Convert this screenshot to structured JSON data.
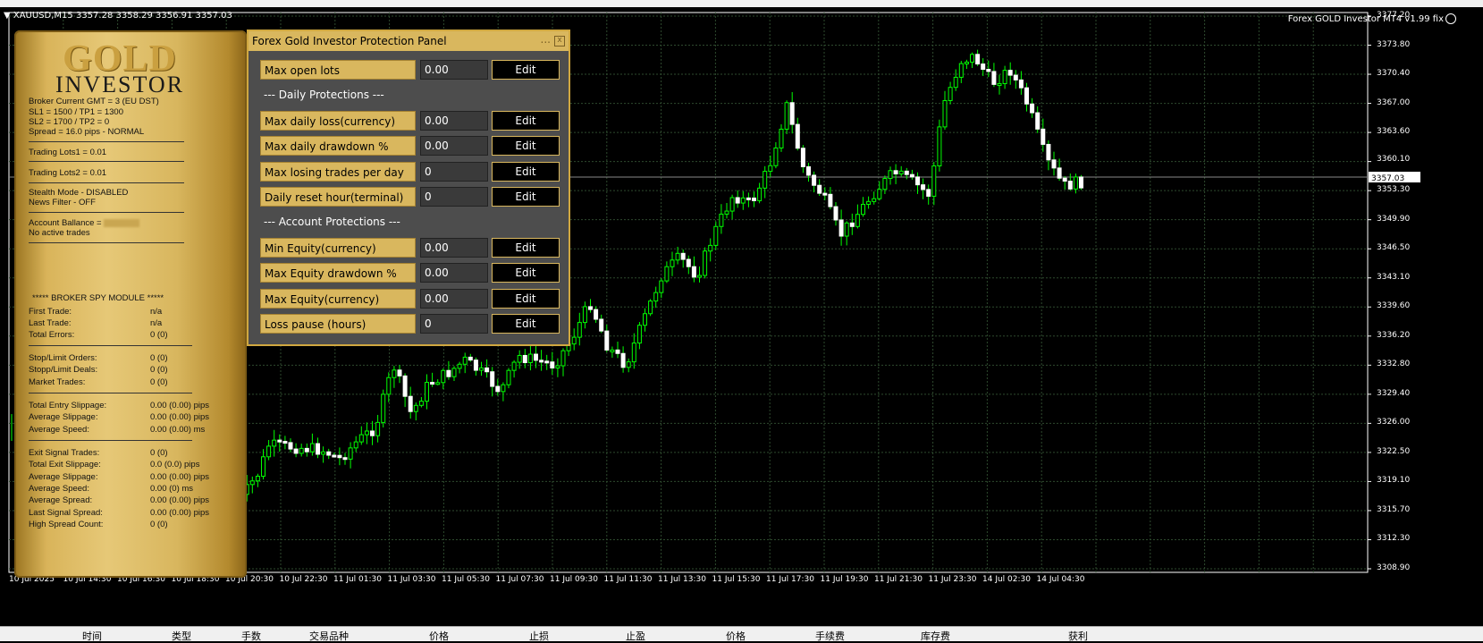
{
  "chart": {
    "title": "▼ XAUUSD,M15  3357.28 3358.29 3356.91 3357.03",
    "ea_title": "Forex GOLD Investor MT4 v1.99 fix",
    "current_price": "3357.03",
    "y_labels": [
      "3377.20",
      "3373.80",
      "3370.40",
      "3367.00",
      "3363.60",
      "3360.10",
      "3353.30",
      "3349.90",
      "3346.50",
      "3343.10",
      "3339.60",
      "3336.20",
      "3332.80",
      "3329.40",
      "3326.00",
      "3322.50",
      "3319.10",
      "3315.70",
      "3312.30",
      "3308.90"
    ],
    "x_labels": [
      "10 Jul 2025",
      "10 Jul 14:30",
      "10 Jul 16:30",
      "10 Jul 18:30",
      "10 Jul 20:30",
      "10 Jul 22:30",
      "11 Jul 01:30",
      "11 Jul 03:30",
      "11 Jul 05:30",
      "11 Jul 07:30",
      "11 Jul 09:30",
      "11 Jul 11:30",
      "11 Jul 13:30",
      "11 Jul 15:30",
      "11 Jul 17:30",
      "11 Jul 19:30",
      "11 Jul 21:30",
      "11 Jul 23:30",
      "14 Jul 02:30",
      "14 Jul 04:30"
    ],
    "colors": {
      "bull": "#00ff00",
      "bear": "#ffffff",
      "grid": "#2e4a2e",
      "background": "#000000"
    }
  },
  "gold_panel": {
    "logo_top": "GOLD",
    "logo_bottom": "INVESTOR",
    "info": [
      "Broker Current GMT = 3  (EU DST)",
      "SL1 = 1500 / TP1 = 1300",
      "SL2 = 1700 / TP2 = 0",
      "Spread = 16.0 pips - NORMAL",
      "Trading Lots1 = 0.01",
      "Trading Lots2 = 0.01",
      "Stealth Mode - DISABLED",
      "News Filter - OFF",
      "Account Ballance =",
      "No active trades"
    ],
    "spy_title": "***** BROKER SPY MODULE *****",
    "stats": [
      {
        "label": "First Trade:",
        "value": "n/a"
      },
      {
        "label": "Last Trade:",
        "value": "n/a"
      },
      {
        "label": "Total Errors:",
        "value": "0 (0)"
      },
      {
        "label": "Stop/Limit Orders:",
        "value": "0 (0)"
      },
      {
        "label": "Stopp/Limit Deals:",
        "value": "0 (0)"
      },
      {
        "label": "Market Trades:",
        "value": "0 (0)"
      },
      {
        "label": "Total Entry Slippage:",
        "value": "0.00 (0.00) pips"
      },
      {
        "label": "Average Slippage:",
        "value": "0.00 (0.00) pips"
      },
      {
        "label": "Average Speed:",
        "value": "0.00 (0.00) ms"
      },
      {
        "label": "Exit Signal Trades:",
        "value": "0 (0)"
      },
      {
        "label": "Total Exit Slippage:",
        "value": "0.0 (0.0) pips"
      },
      {
        "label": "Average Slippage:",
        "value": "0.00 (0.00) pips"
      },
      {
        "label": "Average Speed:",
        "value": "0.00 (0) ms"
      },
      {
        "label": "Average Spread:",
        "value": "0.00 (0.00) pips"
      },
      {
        "label": "Last Signal Spread:",
        "value": "0.00 (0.00) pips"
      },
      {
        "label": "High Spread Count:",
        "value": "0 (0)"
      }
    ]
  },
  "protection_panel": {
    "title": "Forex Gold Investor Protection Panel",
    "min_glyph": "...",
    "close_glyph": "x",
    "daily_header": "--- Daily Protections ---",
    "account_header": "--- Account Protections ---",
    "edit_label": "Edit",
    "rows": [
      {
        "label": "Max open lots",
        "value": "0.00"
      },
      {
        "label": "Max daily loss(currency)",
        "value": "0.00"
      },
      {
        "label": "Max daily drawdown %",
        "value": "0.00"
      },
      {
        "label": "Max losing trades per day",
        "value": "0"
      },
      {
        "label": "Daily reset hour(terminal)",
        "value": "0"
      },
      {
        "label": "Min Equity(currency)",
        "value": "0.00"
      },
      {
        "label": "Max Equity drawdown %",
        "value": "0.00"
      },
      {
        "label": "Max Equity(currency)",
        "value": "0.00"
      },
      {
        "label": "Loss pause (hours)",
        "value": "0"
      }
    ]
  },
  "bottom_bar": [
    "时间",
    "类型",
    "手数",
    "交易品种",
    "价格",
    "止损",
    "止盈",
    "价格",
    "手续费",
    "库存费",
    "获利"
  ]
}
